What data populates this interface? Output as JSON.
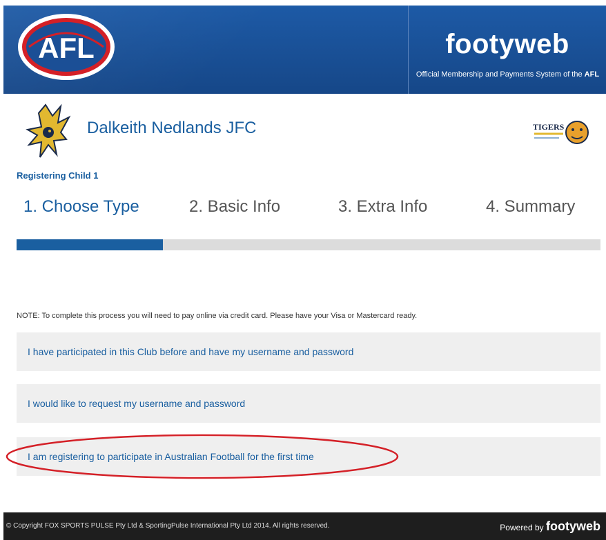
{
  "header": {
    "afl_logo_text": "AFL",
    "brand_title": "footyweb",
    "brand_subtitle_prefix": "Official Membership and Payments System of the ",
    "brand_subtitle_bold": "AFL"
  },
  "club": {
    "name": "Dalkeith Nedlands JFC",
    "partner_logo_text": "TIGERS"
  },
  "registration": {
    "child_label": "Registering Child 1",
    "steps": [
      {
        "label": "1. Choose Type",
        "active": true
      },
      {
        "label": "2. Basic Info",
        "active": false
      },
      {
        "label": "3. Extra Info",
        "active": false
      },
      {
        "label": "4. Summary",
        "active": false
      }
    ],
    "progress_fraction": 0.25
  },
  "note": "NOTE: To complete this process you will need to pay online via credit card. Please have your Visa or Mastercard ready.",
  "options": [
    "I have participated in this Club before and have my username and password",
    "I would like to request my username and password",
    "I am registering to participate in Australian Football for the first time"
  ],
  "footer": {
    "copyright": "© Copyright FOX SPORTS PULSE Pty Ltd & SportingPulse International Pty Ltd  2014.  All rights reserved.",
    "powered_prefix": "Powered by ",
    "powered_brand": "footyweb"
  },
  "colors": {
    "header_blue": "#1b4f96",
    "accent_blue": "#1a5fa0",
    "annotation_red": "#d42027",
    "footer_bg": "#1e1e1e"
  }
}
